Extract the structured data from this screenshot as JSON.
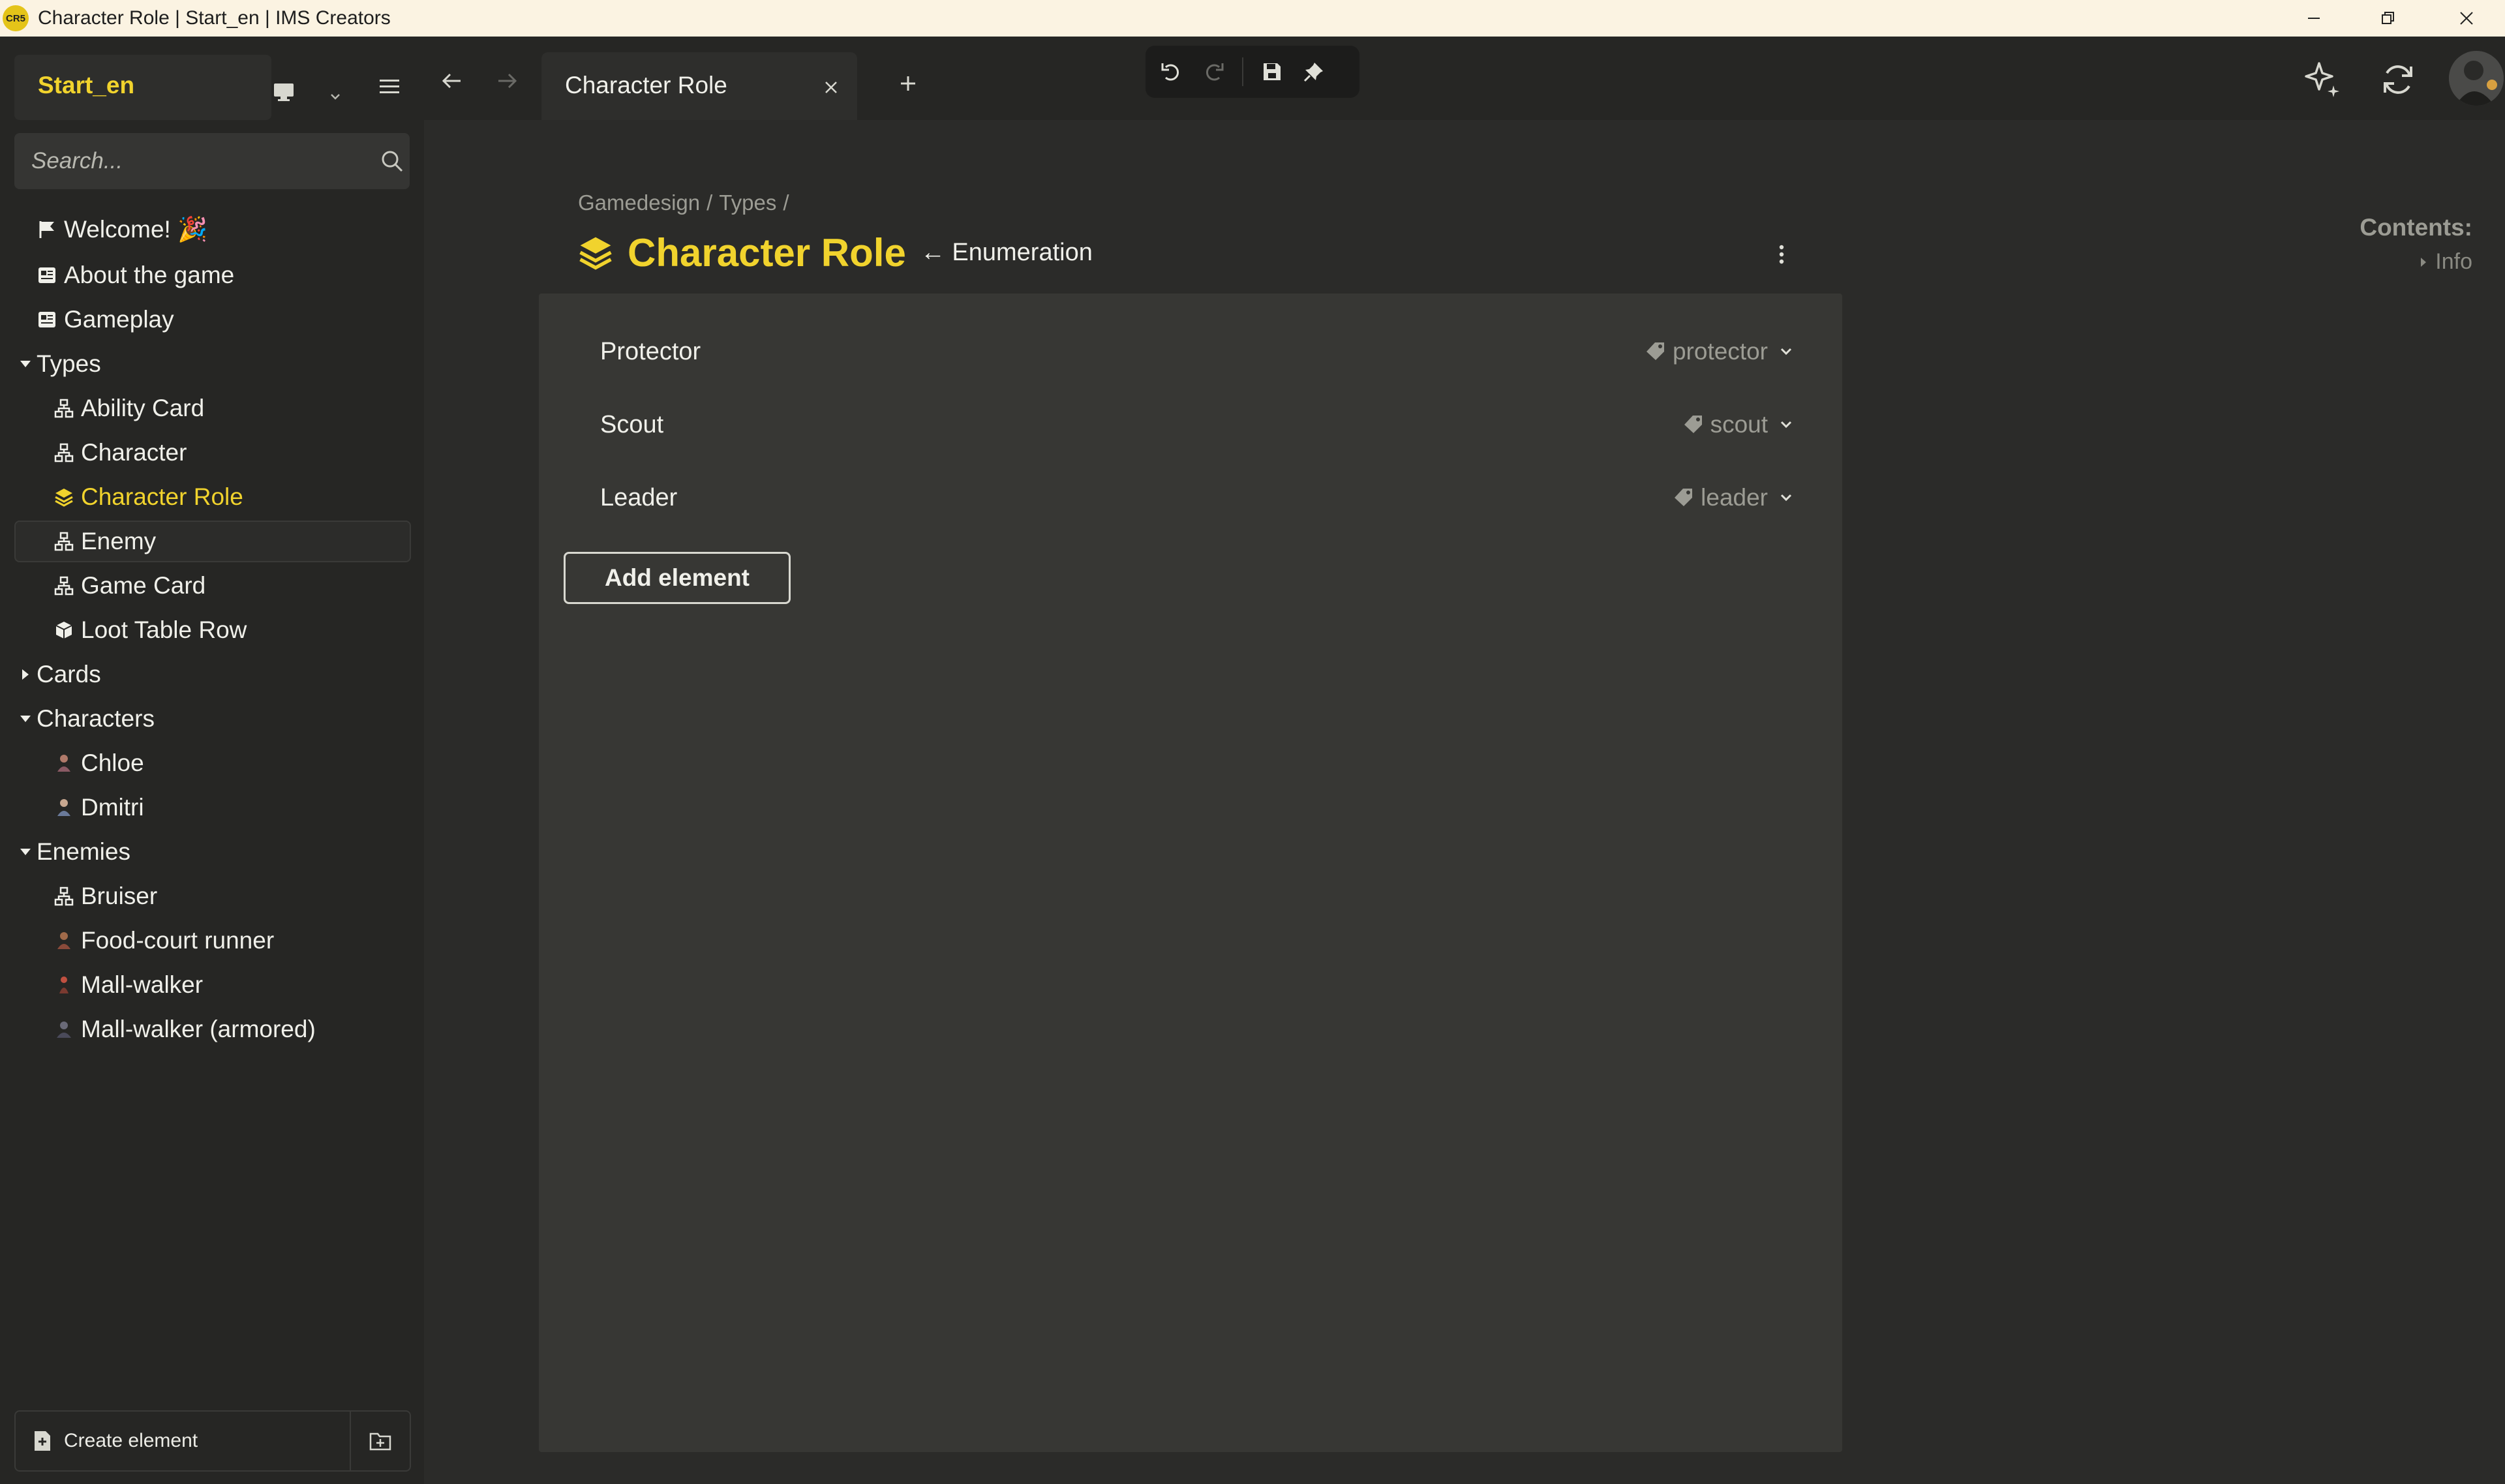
{
  "window": {
    "logo_text": "CR5",
    "title": "Character Role | Start_en | IMS Creators"
  },
  "colors": {
    "accent": "#f1d32d",
    "muted": "#9c9c94"
  },
  "sidebar": {
    "project_name": "Start_en",
    "search_placeholder": "Search...",
    "items": [
      {
        "label": "Welcome! 🎉",
        "icon": "flag-icon"
      },
      {
        "label": "About the game",
        "icon": "article-icon"
      },
      {
        "label": "Gameplay",
        "icon": "article-icon"
      },
      {
        "label": "Types",
        "icon": "caret-down-icon"
      },
      {
        "label": "Ability Card",
        "icon": "type-icon"
      },
      {
        "label": "Character",
        "icon": "type-icon"
      },
      {
        "label": "Character Role",
        "icon": "enum-stack-icon"
      },
      {
        "label": "Enemy",
        "icon": "type-icon"
      },
      {
        "label": "Game Card",
        "icon": "type-icon"
      },
      {
        "label": "Loot Table Row",
        "icon": "cube-icon"
      },
      {
        "label": "Cards",
        "icon": "caret-right-icon"
      },
      {
        "label": "Characters",
        "icon": "caret-down-icon"
      },
      {
        "label": "Chloe",
        "icon": "character-icon"
      },
      {
        "label": "Dmitri",
        "icon": "character-icon"
      },
      {
        "label": "Enemies",
        "icon": "caret-down-icon"
      },
      {
        "label": "Bruiser",
        "icon": "type-icon"
      },
      {
        "label": "Food-court runner",
        "icon": "character-icon"
      },
      {
        "label": "Mall-walker",
        "icon": "character-icon"
      },
      {
        "label": "Mall-walker (armored)",
        "icon": "character-icon"
      }
    ],
    "create_element_label": "Create element"
  },
  "tabs": {
    "active_label": "Character Role"
  },
  "content": {
    "breadcrumb": [
      "Gamedesign",
      "/",
      "Types",
      "/"
    ],
    "title": "Character Role",
    "base_type": "← Enumeration",
    "rows": [
      {
        "label": "Protector",
        "value": "protector"
      },
      {
        "label": "Scout",
        "value": "scout"
      },
      {
        "label": "Leader",
        "value": "leader"
      }
    ],
    "add_element_label": "Add element",
    "toc_title": "Contents:",
    "toc_items": [
      "Info"
    ]
  }
}
